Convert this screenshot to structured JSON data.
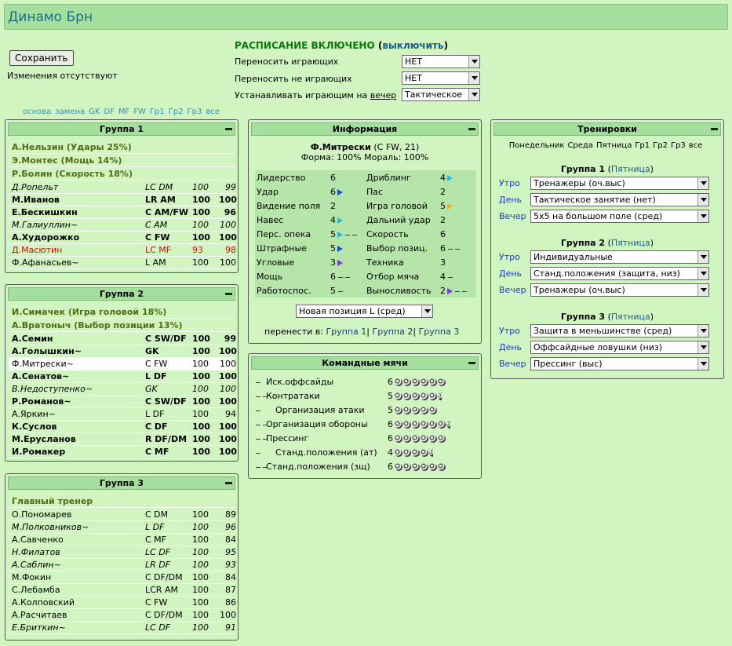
{
  "title": "Динамо Брн",
  "save_label": "Сохранить",
  "changes_note": "Изменения отсутствуют",
  "schedule": {
    "heading": "РАСПИСАНИЕ ВКЛЮЧЕНО",
    "paren_open": "(",
    "disable_link": "выключить",
    "paren_close": ")",
    "rows": [
      {
        "label": "Переносить играющих",
        "value": "НЕТ"
      },
      {
        "label": "Переносить не играющих",
        "value": "НЕТ"
      },
      {
        "label_pre": "Устанавливать играющим на ",
        "label_link": "вечер",
        "value": "Тактическое"
      }
    ]
  },
  "filters": [
    "основа",
    "замена",
    "GK",
    "DF",
    "MF",
    "FW",
    "Гр1",
    "Гр2",
    "Гр3",
    "все"
  ],
  "group1": {
    "title": "Группа 1",
    "captains": [
      "А.Нельзин (Удары 25%)",
      "Э.Монтес (Мощь 14%)",
      "Р.Болин (Скорость 18%)"
    ],
    "players": [
      {
        "name": "Д.Ропельт",
        "pos": "LC DM",
        "v1": "100",
        "v2": "99",
        "style": "i"
      },
      {
        "name": "М.Иванов",
        "pos": "LR AM",
        "v1": "100",
        "v2": "100",
        "style": "b"
      },
      {
        "name": "Е.Бескишкин",
        "pos": "C AM/FW",
        "v1": "100",
        "v2": "96",
        "style": "b"
      },
      {
        "name": "М.Галиуллин~",
        "pos": "C AM",
        "v1": "100",
        "v2": "100",
        "style": "i"
      },
      {
        "name": "А.Худорожко",
        "pos": "C FW",
        "v1": "100",
        "v2": "100",
        "style": "b"
      },
      {
        "name": "Д.Масютин",
        "pos": "LC MF",
        "v1": "93",
        "v2": "98",
        "style": "red"
      },
      {
        "name": "Ф.Афанасьев~",
        "pos": "L AM",
        "v1": "100",
        "v2": "100",
        "style": ""
      }
    ]
  },
  "group2": {
    "title": "Группа 2",
    "captains": [
      "И.Симачек (Игра головой 18%)",
      "А.Вратоныч (Выбор позиции 13%)"
    ],
    "players": [
      {
        "name": "А.Семин",
        "pos": "C SW/DF",
        "v1": "100",
        "v2": "99",
        "style": "b"
      },
      {
        "name": "А.Голышкин~",
        "pos": "GK",
        "v1": "100",
        "v2": "100",
        "style": "b"
      },
      {
        "name": "Ф.Митрески~",
        "pos": "C FW",
        "v1": "100",
        "v2": "100",
        "style": "hl"
      },
      {
        "name": "А.Сенатов~",
        "pos": "L DF",
        "v1": "100",
        "v2": "100",
        "style": "b"
      },
      {
        "name": "В.Недоступенко~",
        "pos": "GK",
        "v1": "100",
        "v2": "100",
        "style": "i"
      },
      {
        "name": "Р.Романов~",
        "pos": "C SW/DF",
        "v1": "100",
        "v2": "100",
        "style": "b"
      },
      {
        "name": "А.Яркин~",
        "pos": "L DF",
        "v1": "100",
        "v2": "94",
        "style": ""
      },
      {
        "name": "К.Суслов",
        "pos": "C DF",
        "v1": "100",
        "v2": "100",
        "style": "b"
      },
      {
        "name": "М.Ерусланов",
        "pos": "R DF/DM",
        "v1": "100",
        "v2": "100",
        "style": "b"
      },
      {
        "name": "И.Ромакер",
        "pos": "C MF",
        "v1": "100",
        "v2": "100",
        "style": "b"
      }
    ]
  },
  "group3": {
    "title": "Группа 3",
    "captains": [
      "Главный тренер"
    ],
    "players": [
      {
        "name": "О.Пономарев",
        "pos": "C DM",
        "v1": "100",
        "v2": "89",
        "style": ""
      },
      {
        "name": "М.Полковников~",
        "pos": "L DF",
        "v1": "100",
        "v2": "96",
        "style": "i"
      },
      {
        "name": "А.Савченко",
        "pos": "C MF",
        "v1": "100",
        "v2": "84",
        "style": ""
      },
      {
        "name": "Н.Филатов",
        "pos": "LC DF",
        "v1": "100",
        "v2": "95",
        "style": "i"
      },
      {
        "name": "А.Саблин~",
        "pos": "LR DF",
        "v1": "100",
        "v2": "93",
        "style": "i"
      },
      {
        "name": "М.Фокин",
        "pos": "C DF/DM",
        "v1": "100",
        "v2": "84",
        "style": ""
      },
      {
        "name": "С.Лебамба",
        "pos": "LCR AM",
        "v1": "100",
        "v2": "87",
        "style": ""
      },
      {
        "name": "А.Колповский",
        "pos": "C FW",
        "v1": "100",
        "v2": "86",
        "style": ""
      },
      {
        "name": "А.Расчитаев",
        "pos": "C DF/DM",
        "v1": "100",
        "v2": "100",
        "style": ""
      },
      {
        "name": "Е.Бриткин~",
        "pos": "LC DF",
        "v1": "100",
        "v2": "91",
        "style": "i"
      }
    ]
  },
  "info": {
    "title": "Информация",
    "player_name": "Ф.Митрески",
    "player_meta": "(C FW, 21)",
    "form_line": "Форма: 100% Мораль: 100%",
    "stats_left": [
      {
        "name": "Лидерство",
        "val": "6",
        "mark": ""
      },
      {
        "name": "Удар",
        "val": "6",
        "mark": "arrow"
      },
      {
        "name": "Видение поля",
        "val": "2",
        "mark": ""
      },
      {
        "name": "Навес",
        "val": "4",
        "mark": "arrow cy"
      },
      {
        "name": "Перс. опека",
        "val": "5",
        "mark": "arrow cy;dash r;dash b"
      },
      {
        "name": "Штрафные",
        "val": "5",
        "mark": "arrow"
      },
      {
        "name": "Угловые",
        "val": "3",
        "mark": "arrow pu"
      },
      {
        "name": "Мощь",
        "val": "6",
        "mark": "dash r;dash b"
      },
      {
        "name": "Работоспос.",
        "val": "5",
        "mark": "dash r"
      }
    ],
    "stats_right": [
      {
        "name": "Дриблинг",
        "val": "4",
        "mark": "arrow cy"
      },
      {
        "name": "Пас",
        "val": "2",
        "mark": ""
      },
      {
        "name": "Игра головой",
        "val": "5",
        "mark": "arrow ye"
      },
      {
        "name": "Дальний удар",
        "val": "2",
        "mark": ""
      },
      {
        "name": "Скорость",
        "val": "6",
        "mark": ""
      },
      {
        "name": "Выбор позиц.",
        "val": "6",
        "mark": "dash r;dash b"
      },
      {
        "name": "Техника",
        "val": "3",
        "mark": ""
      },
      {
        "name": "Отбор мяча",
        "val": "4",
        "mark": "dash r"
      },
      {
        "name": "Выносливость",
        "val": "2",
        "mark": "arrow pu;dash r;dash b"
      }
    ],
    "position_select": "Новая позиция L (сред)",
    "move_label": "перенести в:",
    "move_targets": [
      "Группа 1",
      "Группа 2",
      "Группа 3"
    ]
  },
  "team_balls": {
    "title": "Командные мячи",
    "rows": [
      {
        "name": "Иск.оффсайды",
        "val": "6",
        "balls": 6,
        "dashes": "b",
        "ind": 22
      },
      {
        "name": "Контратаки",
        "val": "5",
        "balls": 5.5,
        "dashes": "r;r",
        "ind": 22
      },
      {
        "name": "Организация атаки",
        "val": "5",
        "balls": 5,
        "dashes": "r",
        "ind": 34
      },
      {
        "name": "Организация обороны",
        "val": "6",
        "balls": 6.5,
        "dashes": "r;b",
        "ind": 22
      },
      {
        "name": "Прессинг",
        "val": "6",
        "balls": 6,
        "dashes": "r;b",
        "ind": 22
      },
      {
        "name": "Станд.положения (ат)",
        "val": "4",
        "balls": 4.5,
        "dashes": "r",
        "ind": 34
      },
      {
        "name": "Станд.положения (зщ)",
        "val": "6",
        "balls": 6,
        "dashes": "b;b",
        "ind": 22
      }
    ]
  },
  "training": {
    "title": "Тренировки",
    "days": [
      "Понедельник",
      "Среда",
      "Пятница",
      "Гр1",
      "Гр2",
      "Гр3",
      "все"
    ],
    "groups": [
      {
        "name": "Группа 1",
        "day": "Пятница",
        "slots": [
          {
            "label": "Утро",
            "value": "Тренажеры (оч.выс)"
          },
          {
            "label": "День",
            "value": "Тактическое занятие (нет)"
          },
          {
            "label": "Вечер",
            "value": "5x5 на большом поле (сред)"
          }
        ]
      },
      {
        "name": "Группа 2",
        "day": "Пятница",
        "slots": [
          {
            "label": "Утро",
            "value": "Индивидуальные"
          },
          {
            "label": "День",
            "value": "Станд.положения (защита, низ)"
          },
          {
            "label": "Вечер",
            "value": "Тренажеры (оч.выс)"
          }
        ]
      },
      {
        "name": "Группа 3",
        "day": "Пятница",
        "slots": [
          {
            "label": "Утро",
            "value": "Защита в меньшинстве (сред)"
          },
          {
            "label": "День",
            "value": "Оффсайдные ловушки (низ)"
          },
          {
            "label": "Вечер",
            "value": "Прессинг (выс)"
          }
        ]
      }
    ]
  }
}
